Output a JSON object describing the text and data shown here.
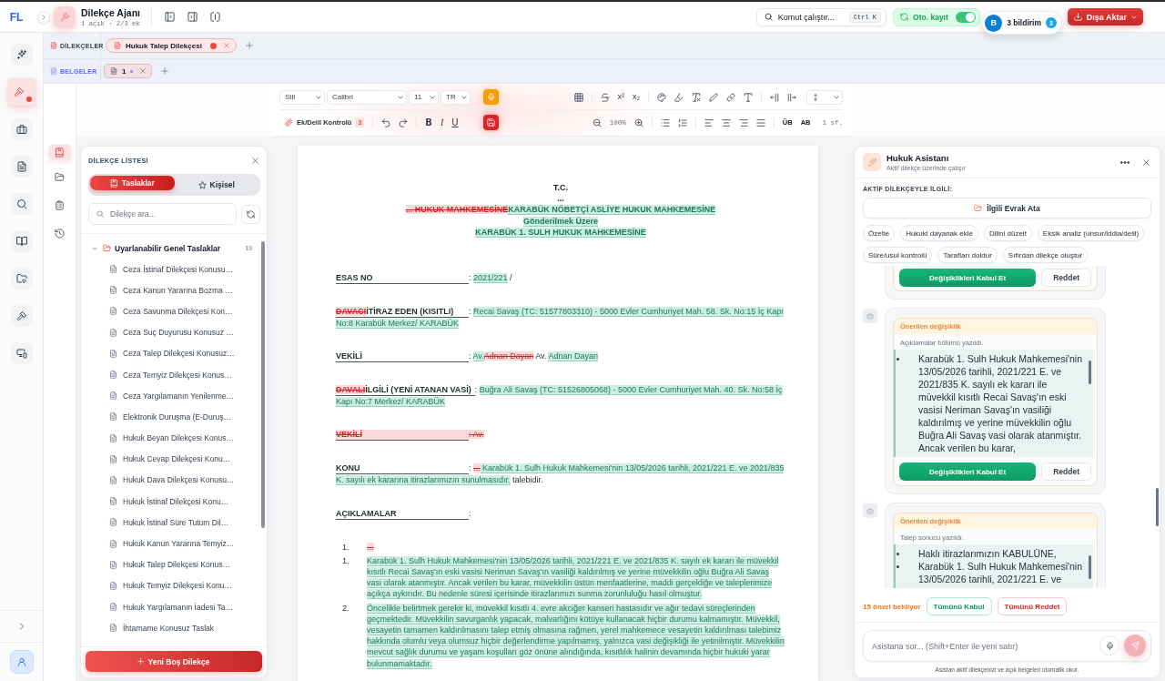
{
  "header": {
    "logo": "FL",
    "title": "Dilekçe Ajanı",
    "subtitle": "1 açık · 2/3 ek",
    "command": {
      "label": "Komut çalıştır...",
      "shortcut": "Ctrl K"
    },
    "autosave": {
      "label": "Oto. kayıt",
      "on": true
    },
    "export_button": "Dışa Aktar"
  },
  "notification": {
    "avatar": "B",
    "label": "3 bildirim",
    "count": "3"
  },
  "rail": {
    "items": [
      {
        "selected": false,
        "alert": false
      },
      {
        "selected": true,
        "alert": true
      },
      {
        "selected": false,
        "alert": false
      },
      {
        "selected": false,
        "alert": false
      },
      {
        "selected": false,
        "alert": false
      },
      {
        "selected": false,
        "alert": false
      },
      {
        "selected": false,
        "alert": false
      },
      {
        "selected": false,
        "alert": false
      },
      {
        "selected": false,
        "alert": false
      }
    ]
  },
  "tab_rows": [
    {
      "kind": "petitions",
      "label": "DİLEKÇELER",
      "tabs": [
        {
          "label": "Hukuk Talep Dilekçesi",
          "selected": true,
          "modified": true
        }
      ]
    },
    {
      "kind": "documents",
      "label": "BELGELER",
      "tabs": [
        {
          "label": "1",
          "selected": true,
          "modified": true
        }
      ]
    }
  ],
  "toolbar": {
    "selects": [
      "Stil",
      "Calibri",
      "11",
      "TR"
    ],
    "script_buttons": [
      "x²",
      "x₂"
    ],
    "evidence_check": {
      "label": "Ek/Delil Kontrolü",
      "count": "3"
    },
    "format_buttons": [
      "B",
      "I",
      "U"
    ],
    "zoom": "100%",
    "case_buttons": [
      "ÜB",
      "AB"
    ],
    "page_count": "1 sf."
  },
  "side_rail": {
    "items": [
      {
        "selected": true
      },
      {
        "selected": false
      },
      {
        "selected": false
      },
      {
        "selected": false
      }
    ]
  },
  "petition_list": {
    "title": "DİLEKÇE LİSTESİ",
    "segments": [
      {
        "label": "Taslaklar",
        "selected": true
      },
      {
        "label": "Kişisel",
        "selected": false
      }
    ],
    "search": {
      "placeholder": "Dilekçe ara..."
    },
    "tree": [
      {
        "label": "Uyarlanabilir Genel Taslaklar",
        "count": "19",
        "expanded": true,
        "children": [
          {
            "label": "Ceza İstinaf Dilekçesi Konusu…"
          },
          {
            "label": "Ceza Kanun Yararına Bozma …"
          },
          {
            "label": "Ceza Savunma Dilekçesi Kon…"
          },
          {
            "label": "Ceza Suç Duyurusu Konusuz …"
          },
          {
            "label": "Ceza Talep Dilekçesi Konusuz…"
          },
          {
            "label": "Ceza Temyiz Dilekçesi Konus…"
          },
          {
            "label": "Ceza Yargılamanın Yenilenme…"
          },
          {
            "label": "Elektronik Duruşma (E-Duruş…"
          },
          {
            "label": "Hukuk Beyan Dilekçesi Konus…"
          },
          {
            "label": "Hukuk Cevap Dilekçesi Konu…"
          },
          {
            "label": "Hukuk Dava Dilekçesi Konusu…"
          },
          {
            "label": "Hukuk İstinaf Dilekçesi Konu…"
          },
          {
            "label": "Hukuk İstinaf Süre Tutum Dil…"
          },
          {
            "label": "Hukuk Kanun Yararına Temyiz…"
          },
          {
            "label": "Hukuk Talep Dilekçesi Konus…"
          },
          {
            "label": "Hukuk Temyiz Dilekçesi Konu…"
          },
          {
            "label": "Hukuk Yargılamanın İadesi Ta…"
          },
          {
            "label": "İhtarname Konusuz Taslak"
          }
        ]
      }
    ],
    "new_button": "Yeni Boş Dilekçe"
  },
  "document": {
    "blocks": [
      {
        "kind": "heading",
        "segments": [
          {
            "text": "T.C.",
            "inserted": false,
            "deleted": false
          }
        ]
      },
      {
        "kind": "heading",
        "segments": [
          {
            "text": "...",
            "inserted": false,
            "deleted": false
          }
        ]
      },
      {
        "kind": "heading",
        "segments": [
          {
            "text": "... HUKUK MAHKEMESİNE",
            "inserted": false,
            "deleted": true
          },
          {
            "text": "KARABÜK NÖBETÇİ ASLİYE HUKUK MAHKEMESİNE",
            "inserted": true,
            "deleted": false
          }
        ]
      },
      {
        "kind": "heading",
        "segments": [
          {
            "text": "Gönderilmek Üzere",
            "inserted": true,
            "deleted": false
          }
        ]
      },
      {
        "kind": "heading",
        "segments": [
          {
            "text": "KARABÜK 1. SULH HUKUK MAHKEMESİNE",
            "inserted": true,
            "deleted": false
          }
        ]
      },
      {
        "kind": "field",
        "label": [
          {
            "text": "ESAS NO",
            "inserted": false,
            "deleted": false
          }
        ],
        "value": [
          {
            "text": ": ",
            "inserted": false,
            "deleted": false
          },
          {
            "text": "2021/221",
            "inserted": true,
            "deleted": false
          },
          {
            "text": "  /",
            "inserted": false,
            "deleted": false
          }
        ]
      },
      {
        "kind": "field",
        "label": [
          {
            "text": "DAVACI",
            "inserted": false,
            "deleted": true
          },
          {
            "text": "İTİRAZ EDEN (KISITLI)",
            "inserted": false,
            "deleted": false
          }
        ],
        "value": [
          {
            "text": ": ",
            "inserted": false,
            "deleted": false
          },
          {
            "text": "Recai Savaş (TC: 51577803310) - 5000 Evler Cumhuriyet Mah. 58. Sk. No:15 İç Kapı No:8 Karabük Merkez/ KARABÜK",
            "inserted": true,
            "deleted": false
          }
        ]
      },
      {
        "kind": "field",
        "label": [
          {
            "text": "VEKİLİ",
            "inserted": false,
            "deleted": false
          }
        ],
        "value": [
          {
            "text": ": ",
            "inserted": false,
            "deleted": false
          },
          {
            "text": "Av.",
            "inserted": true,
            "deleted": false
          },
          {
            "text": "Adnan Dayan",
            "inserted": false,
            "deleted": true
          },
          {
            "text": " Av. ",
            "inserted": false,
            "deleted": false
          },
          {
            "text": "Adnan Dayan",
            "inserted": true,
            "deleted": false
          }
        ]
      },
      {
        "kind": "field",
        "label": [
          {
            "text": "DAVALI",
            "inserted": false,
            "deleted": true
          },
          {
            "text": "İLGİLİ (YENİ ATANAN VASİ)",
            "inserted": false,
            "deleted": false
          }
        ],
        "value": [
          {
            "text": ": ",
            "inserted": false,
            "deleted": false
          },
          {
            "text": "Buğra Ali Savaş (TC: 51526805068) - 5000 Evler Cumhuriyet Mah. 40. Sk. No:58 İç Kapı No:7 Merkez/ KARABÜK",
            "inserted": true,
            "deleted": false
          }
        ]
      },
      {
        "kind": "field",
        "label": [
          {
            "text": "VEKİLİ",
            "inserted": false,
            "deleted": true
          }
        ],
        "value": [
          {
            "text": ": Av.",
            "inserted": false,
            "deleted": true
          }
        ]
      },
      {
        "kind": "field",
        "label": [
          {
            "text": "KONU",
            "inserted": false,
            "deleted": false
          }
        ],
        "value": [
          {
            "text": ": ",
            "inserted": false,
            "deleted": false
          },
          {
            "text": "...",
            "inserted": false,
            "deleted": true
          },
          {
            "text": " Karabük 1. Sulh Hukuk Mahkemesi'nin 13/05/2026 tarihli, 2021/221 E. ve 2021/835 K. sayılı ek kararına itirazlarımızın sunulmasıdır.",
            "inserted": true,
            "deleted": false
          },
          {
            "text": " talebidir.",
            "inserted": false,
            "deleted": false
          }
        ]
      },
      {
        "kind": "field",
        "label": [
          {
            "text": "AÇIKLAMALAR",
            "inserted": false,
            "deleted": false
          }
        ],
        "value": [
          {
            "text": ":",
            "inserted": false,
            "deleted": false
          }
        ]
      },
      {
        "kind": "list_item",
        "number": "1.",
        "segments": [
          {
            "text": "...",
            "inserted": false,
            "deleted": true
          }
        ]
      },
      {
        "kind": "list_item",
        "number": "1.",
        "segments": [
          {
            "text": "Karabük 1. Sulh Hukuk Mahkemesi'nin 13/05/2026 tarihli, 2021/221 E. ve 2021/835 K. sayılı ek kararı ile müvekkil kısıtlı Recai Savaş'ın eski vasisi Neriman Savaş'ın vasiliği kaldırılmış ve yerine müvekkilin oğlu Buğra Ali Savaş vasi olarak atanmıştır. Ancak verilen bu karar, müvekkilin üstün menfaatlerine, maddi gerçekliğe ve taleplerimize açıkça aykırıdır. Bu nedenle süresi içerisinde itirazlarımızı sunma zorunluluğu hasıl olmuştur.",
            "inserted": true,
            "deleted": false
          }
        ]
      },
      {
        "kind": "list_item",
        "number": "2.",
        "segments": [
          {
            "text": "Öncelikle belirtmek gerekir ki, müvekkil kısıtlı 4. evre akciğer kanseri hastasıdır ve ağır tedavi süreçlerinden geçmektedir. Müvekkilin savurganlık yapacak, malvarlığını kötüye kullanacak hiçbir durumu kalmamıştır. Müvekkil, vesayetin tamamen kaldırılmasını talep etmiş olmasına rağmen, yerel mahkemece vesayetin kaldırılması talebimiz hakkında olumlu veya olumsuz hiçbir değerlendirme yapılmamış, yalnızca vasi değişikliği ile yetinilmiştir. Müvekkilin mevcut sağlık durumu ve yaşam koşulları göz önüne alındığında, kısıtlılık halinin devamında hiçbir hukuki yarar bulunmamaktadır.",
            "inserted": true,
            "deleted": false
          }
        ]
      }
    ]
  },
  "assistant": {
    "title": "Hukuk Asistanı",
    "subtitle": "Aktif dilekçe üzerinde çalışır",
    "context_label": "AKTİF DİLEKÇEYLE İLGİLİ:",
    "attach_button": "İlgili Evrak Ata",
    "quick_actions": [
      "Özetle",
      "Hukuki dayanak ekle",
      "Dilini düzelt",
      "Eksik analiz (unsur/iddia/delil)",
      "Süre/usul kontrolü",
      "Tarafları doldur",
      "Sıfırdan dilekçe oluştur"
    ],
    "messages": [
      {
        "accept": "Değişiklikleri Kabul Et",
        "reject": "Reddet"
      },
      {
        "title": "Önerilen değişiklik",
        "summary": "Açıklamalar bölümü yazıldı.",
        "preview": [
          "Karabük 1. Sulh Hukuk Mahkemesi'nin 13/05/2026 tarihli, 2021/221 E. ve 2021/835 K. sayılı ek kararı ile müvekkil kısıtlı Recai Savaş'ın eski vasisi Neriman Savaş'ın vasiliği kaldırılmış ve yerine müvekkilin oğlu Buğra Ali Savaş vasi olarak atanmıştır. Ancak verilen bu karar,"
        ],
        "accept": "Değişiklikleri Kabul Et",
        "reject": "Reddet"
      },
      {
        "title": "Önerilen değişiklik",
        "summary": "Talep sonucu yazıldı.",
        "preview": [
          "Haklı itirazlarımızın KABULÜNE,",
          "Karabük 1. Sulh Hukuk Mahkemesi'nin 13/05/2026 tarihli, 2021/221 E. ve"
        ]
      }
    ],
    "pending": "15 öneri bekliyor",
    "accept_all": "Tümünü Kabul",
    "reject_all": "Tümünü Reddet",
    "input": {
      "placeholder": "Asistana sor... (Shift+Enter ile yeni satır)"
    },
    "footnote": "Asistan aktif dilekçenizi ve açık belgeleri otomatik okur."
  }
}
